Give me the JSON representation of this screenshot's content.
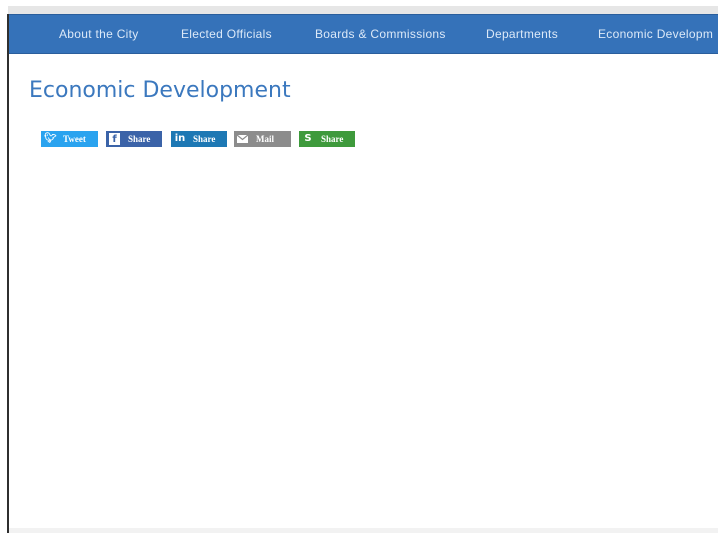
{
  "nav": {
    "items": [
      {
        "label": "About the City"
      },
      {
        "label": "Elected Officials"
      },
      {
        "label": "Boards & Commissions"
      },
      {
        "label": "Departments"
      },
      {
        "label": "Economic Developm"
      }
    ]
  },
  "page": {
    "title": "Economic Development"
  },
  "share": {
    "buttons": [
      {
        "label": "Tweet",
        "icon": "twitter-icon",
        "color": "#2aa3ef"
      },
      {
        "label": "Share",
        "icon": "facebook-icon",
        "color": "#3b63a8"
      },
      {
        "label": "Share",
        "icon": "linkedin-icon",
        "color": "#1d78b4"
      },
      {
        "label": "Mail",
        "icon": "mail-icon",
        "color": "#8c8c8c"
      },
      {
        "label": "Share",
        "icon": "sharethis-icon",
        "color": "#3e9a3c"
      }
    ]
  },
  "colors": {
    "nav_background": "#3572b9",
    "title": "#3b78be"
  }
}
